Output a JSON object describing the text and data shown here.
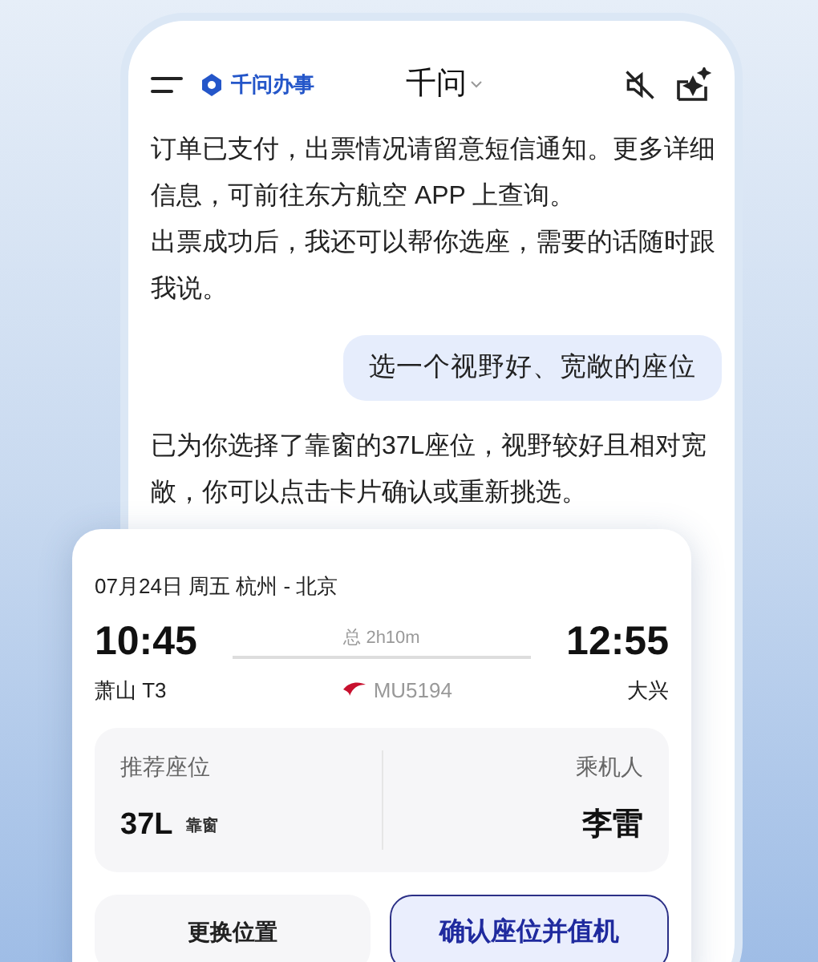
{
  "header": {
    "brand": "千问办事",
    "title": "千问"
  },
  "messages": [
    {
      "kind": "assistant",
      "paragraphs": [
        "订单已支付，出票情况请留意短信通知。更多详细信息，可前往东方航空 APP 上查询。",
        "出票成功后，我还可以帮你选座，需要的话随时跟我说。"
      ]
    },
    {
      "kind": "user",
      "paragraphs": [
        "选一个视野好、宽敞的座位"
      ]
    },
    {
      "kind": "assistant",
      "paragraphs": [
        "已为你选择了靠窗的37L座位，视野较好且相对宽敞，你可以点击卡片确认或重新挑选。"
      ]
    }
  ],
  "flight_card": {
    "date_route": "07月24日 周五 杭州 - 北京",
    "depart_time": "10:45",
    "arrive_time": "12:55",
    "duration": "总 2h10m",
    "depart_airport": "萧山 T3",
    "flight_no": "MU5194",
    "arrive_airport": "大兴",
    "seat_label": "推荐座位",
    "seat": "37L",
    "seat_tag": "靠窗",
    "passenger_label": "乘机人",
    "passenger": "李雷",
    "buttons": [
      {
        "label": "更换位置",
        "primary": false
      },
      {
        "label": "确认座位并值机",
        "primary": true
      }
    ]
  }
}
